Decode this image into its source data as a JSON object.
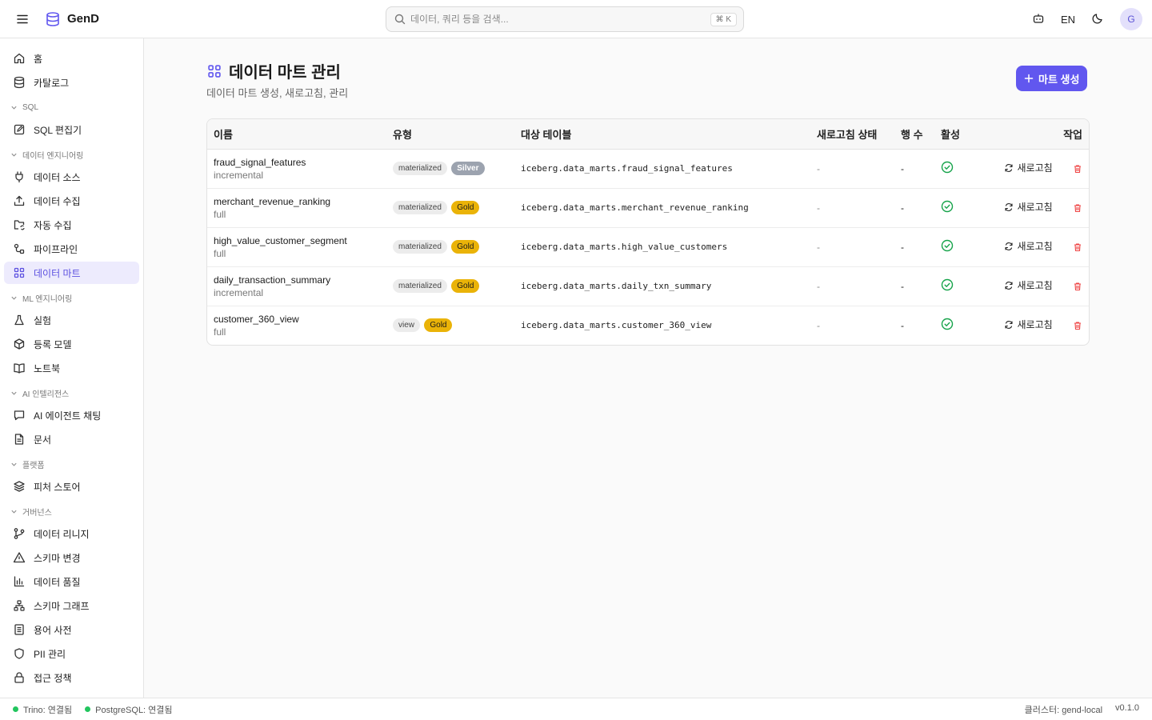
{
  "app": {
    "name": "GenD"
  },
  "search": {
    "placeholder": "데이터, 쿼리 등을 검색...",
    "shortcut": "⌘ K"
  },
  "topbar": {
    "language": "EN",
    "avatar_initial": "G"
  },
  "sidebar": {
    "top_items": [
      {
        "label": "홈",
        "icon": "home-icon"
      },
      {
        "label": "카탈로그",
        "icon": "database-icon"
      }
    ],
    "sections": [
      {
        "title": "SQL",
        "items": [
          {
            "label": "SQL 편집기",
            "icon": "edit-icon"
          }
        ]
      },
      {
        "title": "데이터 엔지니어링",
        "items": [
          {
            "label": "데이터 소스",
            "icon": "plug-icon"
          },
          {
            "label": "데이터 수집",
            "icon": "upload-icon"
          },
          {
            "label": "자동 수집",
            "icon": "folder-sync-icon"
          },
          {
            "label": "파이프라인",
            "icon": "pipeline-icon"
          },
          {
            "label": "데이터 마트",
            "icon": "grid-icon",
            "active": true
          }
        ]
      },
      {
        "title": "ML 엔지니어링",
        "items": [
          {
            "label": "실험",
            "icon": "flask-icon"
          },
          {
            "label": "등록 모델",
            "icon": "box-icon"
          },
          {
            "label": "노트북",
            "icon": "book-icon"
          }
        ]
      },
      {
        "title": "AI 인텔리전스",
        "items": [
          {
            "label": "AI 에이전트 채팅",
            "icon": "chat-icon"
          },
          {
            "label": "문서",
            "icon": "document-icon"
          }
        ]
      },
      {
        "title": "플랫폼",
        "items": [
          {
            "label": "피처 스토어",
            "icon": "layers-icon"
          }
        ]
      },
      {
        "title": "거버넌스",
        "items": [
          {
            "label": "데이터 리니지",
            "icon": "git-branch-icon"
          },
          {
            "label": "스키마 변경",
            "icon": "warning-icon"
          },
          {
            "label": "데이터 품질",
            "icon": "bar-chart-icon"
          },
          {
            "label": "스키마 그래프",
            "icon": "network-icon"
          },
          {
            "label": "용어 사전",
            "icon": "glossary-icon"
          },
          {
            "label": "PII 관리",
            "icon": "shield-icon"
          },
          {
            "label": "접근 정책",
            "icon": "lock-icon"
          }
        ]
      }
    ]
  },
  "page": {
    "title": "데이터 마트 관리",
    "subtitle": "데이터 마트 생성, 새로고침, 관리",
    "create_label": "마트 생성"
  },
  "table": {
    "columns": [
      "이름",
      "유형",
      "대상 테이블",
      "새로고침 상태",
      "행 수",
      "활성",
      "작업"
    ],
    "refresh_label": "새로고침",
    "rows": [
      {
        "name": "fraud_signal_features",
        "mode": "incremental",
        "kind": "materialized",
        "tier": "Silver",
        "target": "iceberg.data_marts.fraud_signal_features",
        "status": "-",
        "rows": "-"
      },
      {
        "name": "merchant_revenue_ranking",
        "mode": "full",
        "kind": "materialized",
        "tier": "Gold",
        "target": "iceberg.data_marts.merchant_revenue_ranking",
        "status": "-",
        "rows": "-"
      },
      {
        "name": "high_value_customer_segment",
        "mode": "full",
        "kind": "materialized",
        "tier": "Gold",
        "target": "iceberg.data_marts.high_value_customers",
        "status": "-",
        "rows": "-"
      },
      {
        "name": "daily_transaction_summary",
        "mode": "incremental",
        "kind": "materialized",
        "tier": "Gold",
        "target": "iceberg.data_marts.daily_txn_summary",
        "status": "-",
        "rows": "-"
      },
      {
        "name": "customer_360_view",
        "mode": "full",
        "kind": "view",
        "tier": "Gold",
        "target": "iceberg.data_marts.customer_360_view",
        "status": "-",
        "rows": "-"
      }
    ]
  },
  "statusbar": {
    "trino": "Trino: 연결됨",
    "postgres": "PostgreSQL: 연결됨",
    "cluster": "클러스터: gend-local",
    "version": "v0.1.0"
  },
  "colors": {
    "accent": "#6157ef",
    "gold": "#eab308",
    "silver": "#9ca3af",
    "success": "#22c55e",
    "danger": "#ef4444"
  }
}
